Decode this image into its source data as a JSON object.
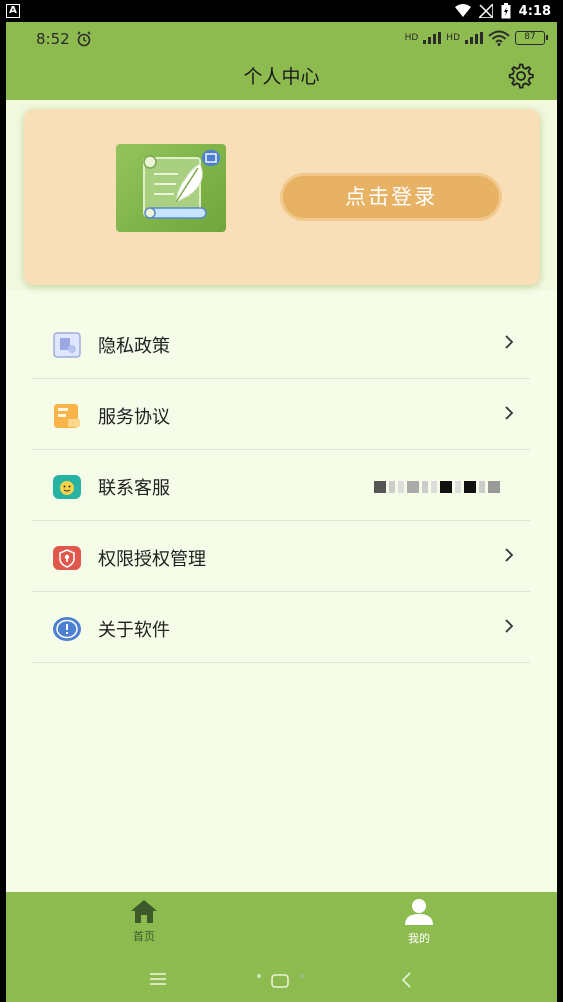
{
  "system_bar": {
    "time": "4:18"
  },
  "status_bar": {
    "time": "8:52",
    "hd1": "HD",
    "hd2": "HD",
    "battery": "87"
  },
  "header": {
    "title": "个人中心"
  },
  "login": {
    "button_label": "点击登录"
  },
  "menu": {
    "items": [
      {
        "label": "隐私政策",
        "icon": "privacy-doc-icon"
      },
      {
        "label": "服务协议",
        "icon": "service-box-icon"
      },
      {
        "label": "联系客服",
        "icon": "customer-service-icon"
      },
      {
        "label": "权限授权管理",
        "icon": "permission-lock-icon"
      },
      {
        "label": "关于软件",
        "icon": "info-bubble-icon"
      }
    ]
  },
  "bottom_nav": {
    "home_label": "首页",
    "mine_label": "我的"
  },
  "colors": {
    "accent_green": "#8dbb50",
    "card_peach": "#f8dfb7",
    "login_orange": "#e8b265",
    "page_bg": "#f5fce8"
  }
}
